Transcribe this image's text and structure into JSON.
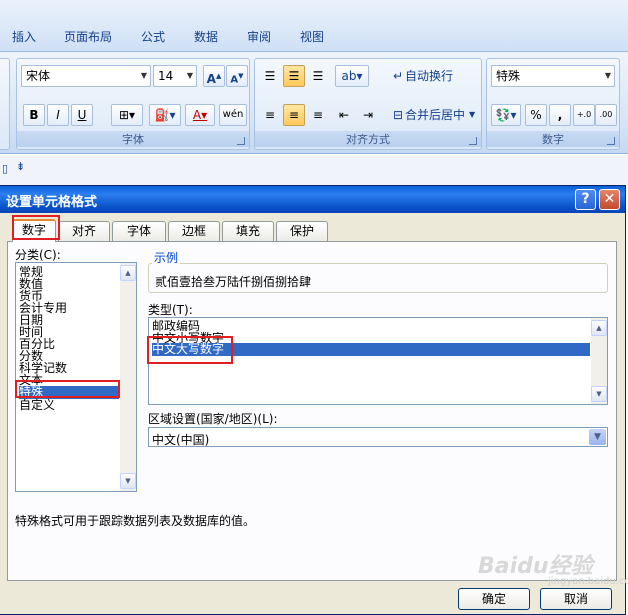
{
  "ribbon": {
    "tabs": [
      "插入",
      "页面布局",
      "公式",
      "数据",
      "审阅",
      "视图"
    ],
    "font_name": "宋体",
    "font_size": "14",
    "wrap_text": "自动换行",
    "merge_center": "合并后居中",
    "number_format": "特殊",
    "groups": {
      "font": "字体",
      "alignment": "对齐方式",
      "number": "数字"
    }
  },
  "dialog": {
    "title": "设置单元格格式",
    "help": "?",
    "close": "✕",
    "tabs": [
      "数字",
      "对齐",
      "字体",
      "边框",
      "填充",
      "保护"
    ],
    "category_label": "分类(C):",
    "categories": [
      "常规",
      "数值",
      "货币",
      "会计专用",
      "日期",
      "时间",
      "百分比",
      "分数",
      "科学记数",
      "文本",
      "特殊",
      "自定义"
    ],
    "selected_category": "特殊",
    "sample_label": "示例",
    "sample_value": "贰佰壹拾叁万陆仟捌佰捌拾肆",
    "type_label": "类型(T):",
    "types": [
      "邮政编码",
      "中文小写数字",
      "中文大写数字"
    ],
    "selected_type": "中文大写数字",
    "locale_label": "区域设置(国家/地区)(L):",
    "locale_value": "中文(中国)",
    "description": "特殊格式可用于跟踪数据列表及数据库的值。",
    "ok": "确定",
    "cancel": "取消"
  },
  "watermark": {
    "text": "Baidu经验",
    "sub": "jingyan.baidu.com"
  }
}
